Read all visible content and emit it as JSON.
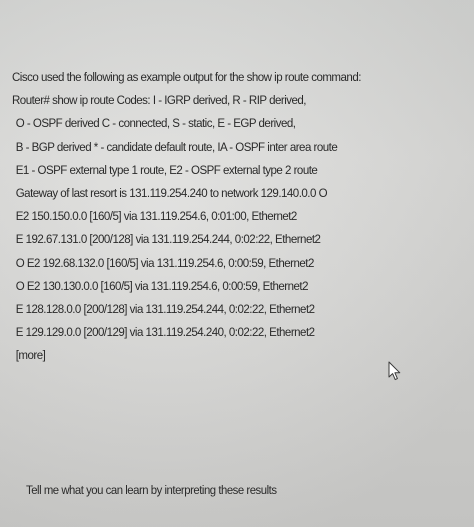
{
  "intro": "Cisco used the following as example output for the show ip route command:",
  "output_lines": [
    "Router# show ip route Codes: I - IGRP derived, R - RIP derived,",
    "O - OSPF derived C - connected, S - static, E - EGP derived,",
    "B - BGP derived * - candidate default route, IA - OSPF inter area route",
    "E1 - OSPF external type 1 route, E2 - OSPF external type 2 route",
    "Gateway of last resort is 131.119.254.240 to network 129.140.0.0 O",
    "E2 150.150.0.0 [160/5] via 131.119.254.6, 0:01:00, Ethernet2",
    "E 192.67.131.0 [200/128] via 131.119.254.244, 0:02:22, Ethernet2",
    "O E2 192.68.132.0 [160/5] via 131.119.254.6, 0:00:59, Ethernet2",
    "O E2 130.130.0.0 [160/5] via 131.119.254.6, 0:00:59, Ethernet2",
    "E 128.128.0.0 [200/128] via 131.119.254.244, 0:02:22, Ethernet2",
    "E 129.129.0.0 [200/129] via 131.119.254.240, 0:02:22, Ethernet2",
    "[more]"
  ],
  "question": "Tell me what you can learn by interpreting these results",
  "icons": {
    "cursor": "mouse-pointer-icon"
  },
  "colors": {
    "background": "#d6d6d4",
    "text": "#2a2a2a"
  }
}
